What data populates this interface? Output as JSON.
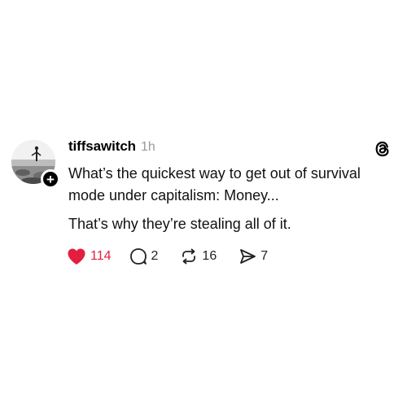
{
  "post": {
    "username": "tiffsawitch",
    "timestamp": "1h",
    "follow_symbol": "+",
    "text_line1": "What’s the quickest way to get out of survival",
    "text_line2": "mode under capitalism: Money...",
    "text_line3": "That’s why they’re stealing all of it.",
    "liked": true
  },
  "actions": {
    "likes": "114",
    "replies": "2",
    "reposts": "16",
    "shares": "7"
  },
  "icons": {
    "like": "heart-filled-icon",
    "reply": "speech-bubble-icon",
    "repost": "repost-arrows-icon",
    "share": "paper-plane-icon",
    "brand": "threads-logo-icon",
    "follow": "plus-icon"
  },
  "colors": {
    "like_red": "#e41e3f",
    "timestamp_gray": "#9a9a9a",
    "text": "#111111"
  }
}
